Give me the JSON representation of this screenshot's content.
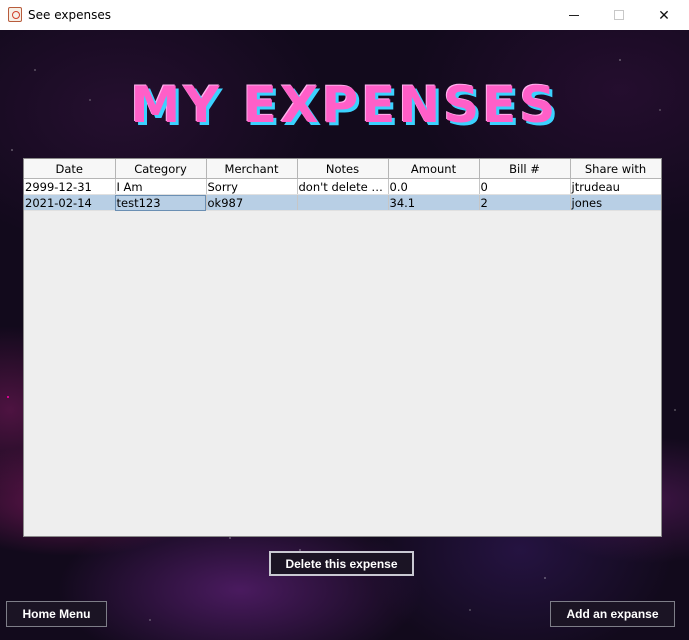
{
  "window": {
    "title": "See expenses"
  },
  "heading": "MY EXPENSES",
  "table": {
    "columns": [
      "Date",
      "Category",
      "Merchant",
      "Notes",
      "Amount",
      "Bill #",
      "Share with"
    ],
    "rows": [
      [
        "2999-12-31",
        "I Am",
        "Sorry",
        "don't delete m...",
        "0.0",
        "0",
        "jtrudeau"
      ],
      [
        "2021-02-14",
        "test123",
        "ok987",
        "",
        "34.1",
        "2",
        "jones"
      ]
    ],
    "selected_row": 1
  },
  "buttons": {
    "delete": "Delete this expense",
    "home": "Home Menu",
    "add": "Add an expanse"
  },
  "colors": {
    "heading": "#ff5fc8",
    "heading_shadow": "#3bd2ff",
    "selection": "#b8cfe5",
    "button_bg": "#1b1424"
  }
}
